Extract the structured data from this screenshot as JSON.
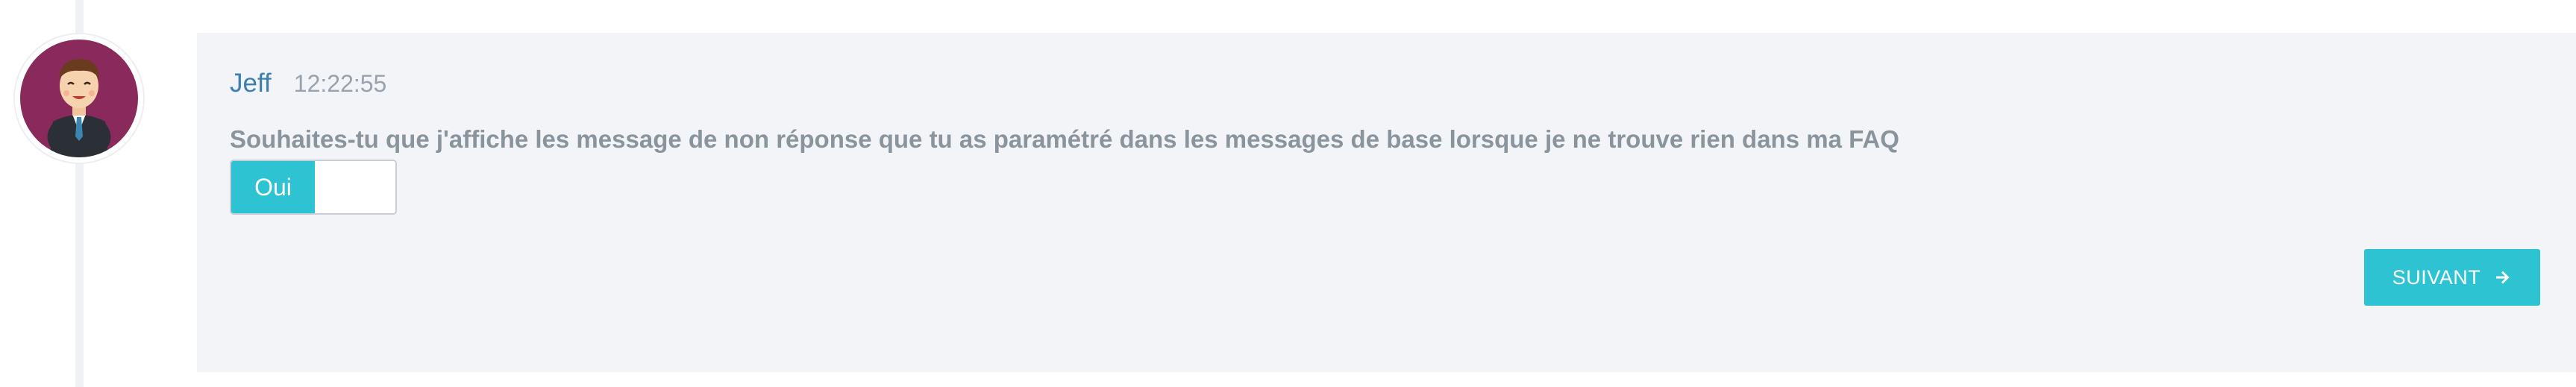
{
  "message": {
    "author": "Jeff",
    "timestamp": "12:22:55",
    "question": "Souhaites-tu que j'affiche les message de non réponse que tu as paramétré dans les messages de base lorsque je ne trouve rien dans ma FAQ"
  },
  "toggle": {
    "on_label": "Oui",
    "state": "on"
  },
  "actions": {
    "next_label": "SUIVANT",
    "next_icon": "arrow-right-icon"
  },
  "colors": {
    "accent": "#2ec3d3",
    "author": "#3d7fb0",
    "panel_bg": "#f3f4f8",
    "avatar_bg": "#8a2a5c"
  }
}
